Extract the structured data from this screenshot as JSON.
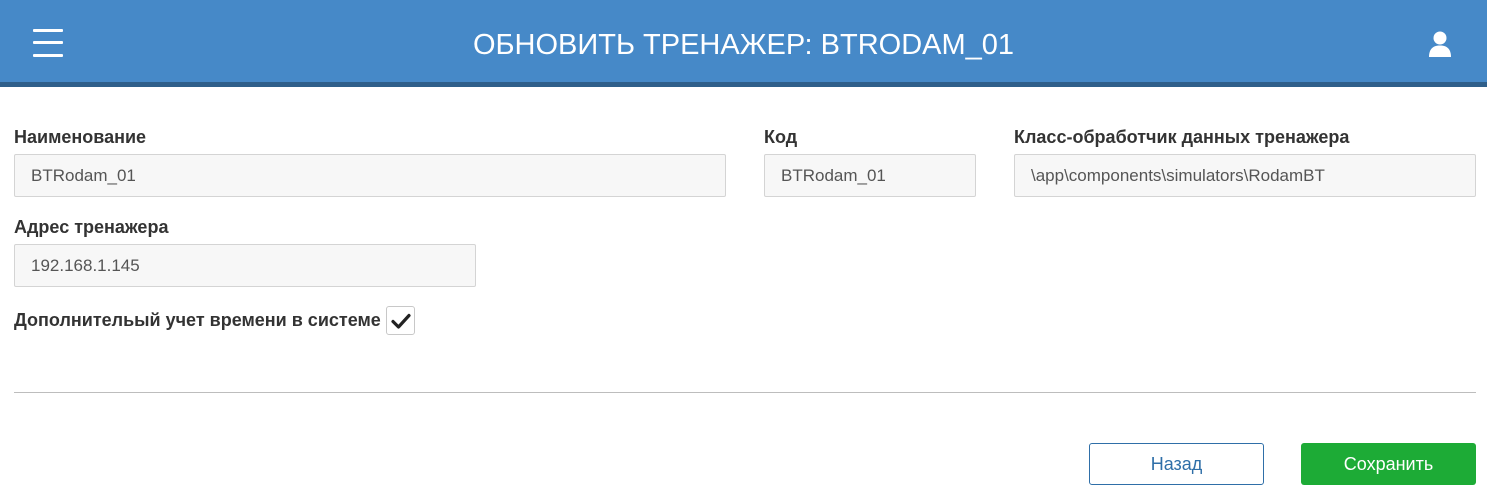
{
  "header": {
    "title": "ОБНОВИТЬ ТРЕНАЖЕР: BTRODAM_01",
    "menu_icon": "hamburger-menu-icon",
    "user_icon": "user-icon",
    "background_color": "#4689c8"
  },
  "form": {
    "name": {
      "label": "Наименование",
      "value": "BTRodam_01"
    },
    "code": {
      "label": "Код",
      "value": "BTRodam_01"
    },
    "handler_class": {
      "label": "Класс-обработчик данных тренажера",
      "value": "\\app\\components\\simulators\\RodamBT"
    },
    "address": {
      "label": "Адрес тренажера",
      "value": "192.168.1.145"
    },
    "extra_time_tracking": {
      "label": "Дополнительый учет времени в системе",
      "checked": true
    }
  },
  "actions": {
    "back_label": "Назад",
    "save_label": "Сохранить",
    "save_color": "#1dab36",
    "back_color": "#2f6fa8"
  }
}
